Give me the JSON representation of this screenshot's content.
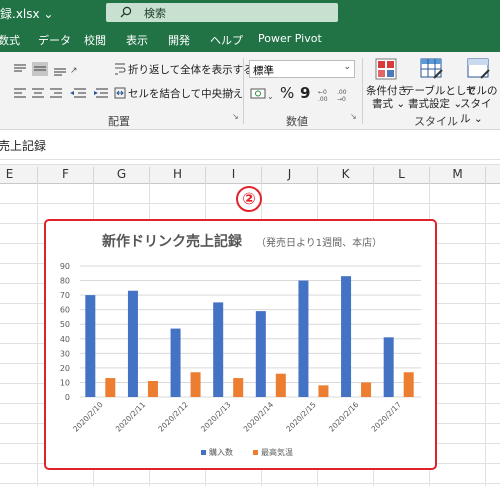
{
  "window": {
    "filename": "録.xlsx ⌄"
  },
  "search": {
    "placeholder": "検索"
  },
  "tabs": [
    "数式",
    "データ",
    "校閲",
    "表示",
    "開発",
    "ヘルプ",
    "Power Pivot"
  ],
  "ribbon": {
    "wrap_text": "折り返して全体を表示する",
    "merge_center": "セルを結合して中央揃え",
    "group_alignment": "配置",
    "number_format": "標準",
    "percent": "%",
    "comma": "9",
    "group_number": "数値",
    "cond_format_line1": "条件付き",
    "cond_format_line2": "書式 ⌄",
    "table_format_line1": "テーブルとして",
    "table_format_line2": "書式設定 ⌄",
    "cell_style_line1": "セルの",
    "cell_style_line2": "スタイル ⌄",
    "group_style": "スタイル"
  },
  "formula_bar": {
    "content": "売上記録"
  },
  "columns": [
    "E",
    "F",
    "G",
    "H",
    "I",
    "J",
    "K",
    "L",
    "M"
  ],
  "annotation": {
    "number": "②"
  },
  "chart_data": {
    "type": "bar",
    "title": "新作ドリンク売上記録",
    "subtitle": "（発売日より1週間、本店）",
    "categories": [
      "2020/2/10",
      "2020/2/11",
      "2020/2/12",
      "2020/2/13",
      "2020/2/14",
      "2020/2/15",
      "2020/2/16",
      "2020/2/17"
    ],
    "series": [
      {
        "name": "購入数",
        "values": [
          70,
          73,
          47,
          65,
          59,
          80,
          83,
          41
        ],
        "color": "#4472c4"
      },
      {
        "name": "最高気温",
        "values": [
          13,
          11,
          17,
          13,
          16,
          8,
          10,
          17
        ],
        "color": "#ed7d31"
      }
    ],
    "yticks": [
      "0",
      "10",
      "20",
      "30",
      "40",
      "50",
      "60",
      "70",
      "80",
      "90"
    ],
    "ylim": [
      0,
      90
    ],
    "grid": true,
    "legend": "bottom"
  }
}
